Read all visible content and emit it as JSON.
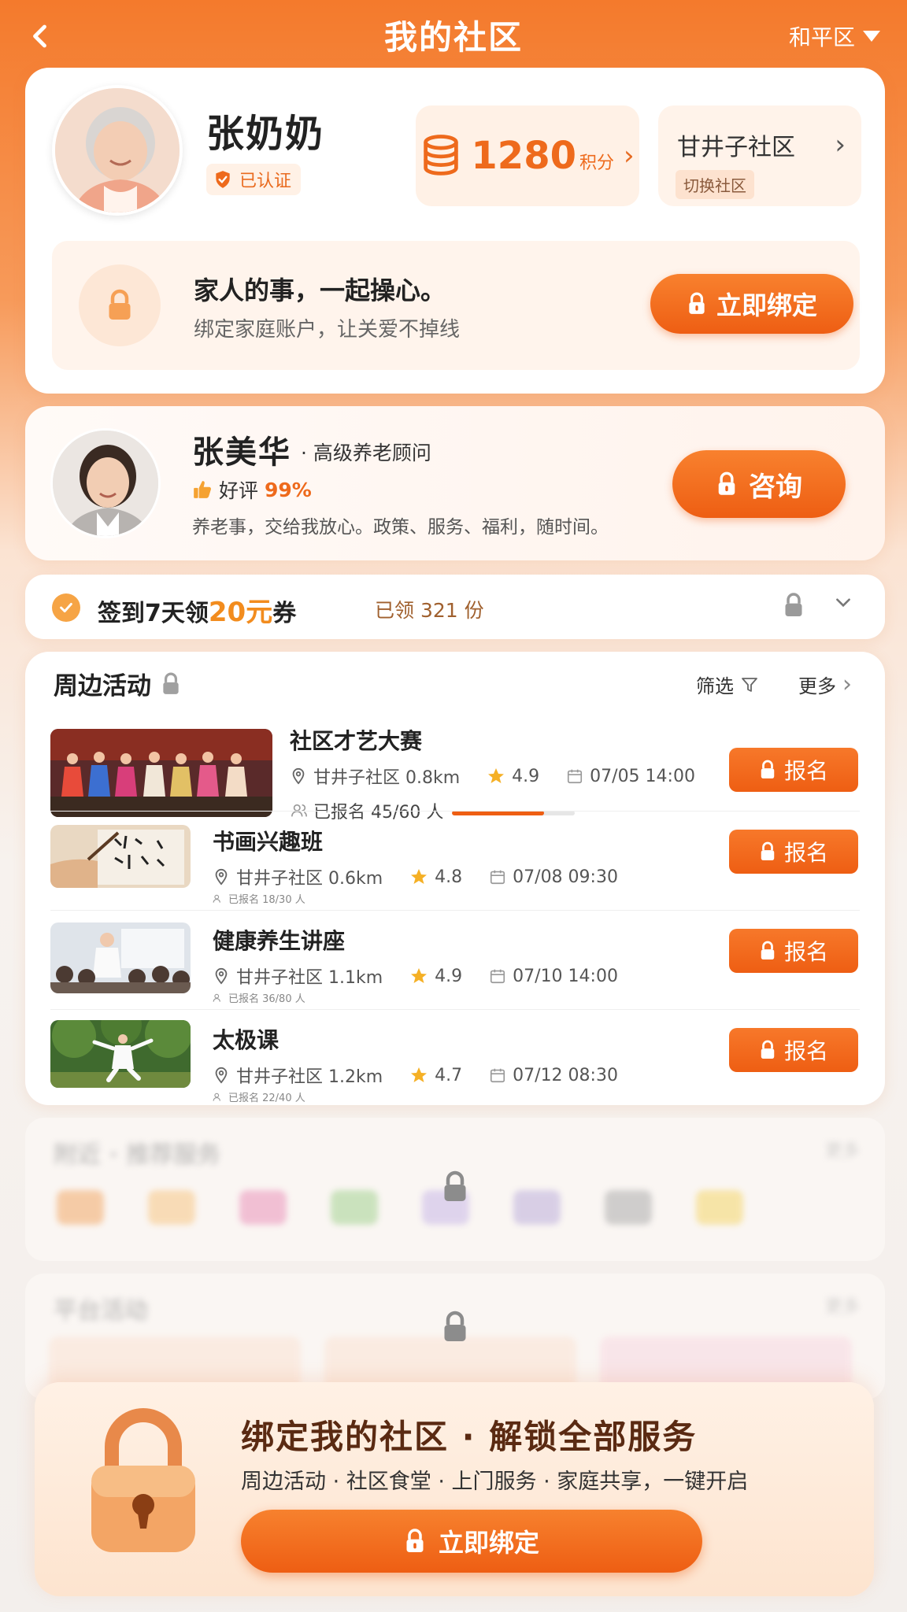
{
  "header": {
    "title": "我的社区",
    "district": "和平区"
  },
  "profile": {
    "name": "张奶奶",
    "verified_label": "已认证",
    "points_value": "1280",
    "points_unit": "积分",
    "community_name": "甘井子社区",
    "switch_label": "切换社区"
  },
  "family": {
    "title": "家人的事，一起操心。",
    "subtitle": "绑定家庭账户，让关爱不掉线",
    "button_label": "立即绑定"
  },
  "advisor": {
    "name": "张美华",
    "title": "· 高级养老顾问",
    "rating_label": "好评",
    "rating_value": "99%",
    "description": "养老事，交给我放心。政策、服务、福利，随时间。",
    "button_label": "咨询"
  },
  "checkin": {
    "text_before": "签到7天领",
    "highlight": "20元",
    "text_after": "券",
    "claimed": "已领 321 份"
  },
  "activities": {
    "title": "周边活动",
    "filter_label": "筛选",
    "more_label": "更多",
    "signup_label": "报名",
    "items": [
      {
        "title": "社区才艺大赛",
        "location": "甘井子社区 0.8km",
        "rating": "4.9",
        "datetime": "07/05 14:00",
        "enrolled": "已报名 45/60 人",
        "progress": 0.75
      },
      {
        "title": "书画兴趣班",
        "location": "甘井子社区 0.6km",
        "rating": "4.8",
        "datetime": "07/08 09:30",
        "enrolled": "已报名 18/30 人"
      },
      {
        "title": "健康养生讲座",
        "location": "甘井子社区 1.1km",
        "rating": "4.9",
        "datetime": "07/10 14:00",
        "enrolled": "已报名 36/80 人"
      },
      {
        "title": "太极课",
        "location": "甘井子社区 1.2km",
        "rating": "4.7",
        "datetime": "07/12 08:30",
        "enrolled": "已报名 22/40 人"
      }
    ]
  },
  "services": {
    "title": "附近 · 推荐服务",
    "more_label": "更多"
  },
  "platform": {
    "title": "平台活动",
    "more_label": "更多"
  },
  "bind_panel": {
    "title": "绑定我的社区 · 解锁全部服务",
    "subtitle": "周边活动 · 社区食堂 · 上门服务 · 家庭共享，一键开启",
    "button_label": "立即绑定"
  },
  "colors": {
    "accent": "#ee5e13",
    "accent_light": "#f8812e",
    "highlight": "#f28c1e"
  }
}
